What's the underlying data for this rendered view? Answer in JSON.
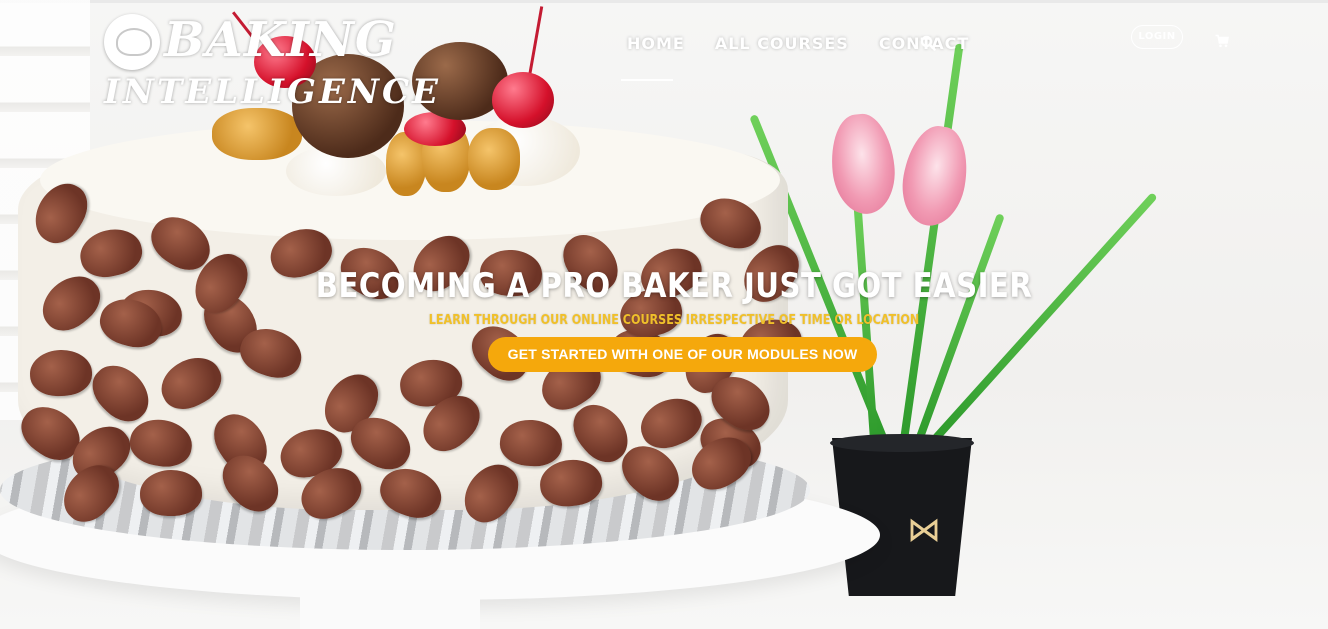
{
  "brand": {
    "logo_line1": "BAKING",
    "logo_line2": "INTELLIGENCE"
  },
  "nav": {
    "items": [
      {
        "label": "HOME",
        "active": true
      },
      {
        "label": "ALL COURSES",
        "active": false
      },
      {
        "label": "CONTACT",
        "active": false
      }
    ],
    "search_icon": "search-icon",
    "login_label": "LOGIN",
    "cart_icon": "cart-icon"
  },
  "hero": {
    "title": "BECOMING A PRO BAKER JUST GOT EASIER",
    "subtitle": "LEARN THROUGH OUR ONLINE COURSES IRRESPECTIVE OF TIME OR LOCATION",
    "cta_label": "GET STARTED WITH ONE OF OUR MODULES NOW"
  },
  "colors": {
    "accent": "#f5a80c",
    "subtitle": "#f0c02a",
    "nav_text": "#ffffff"
  }
}
